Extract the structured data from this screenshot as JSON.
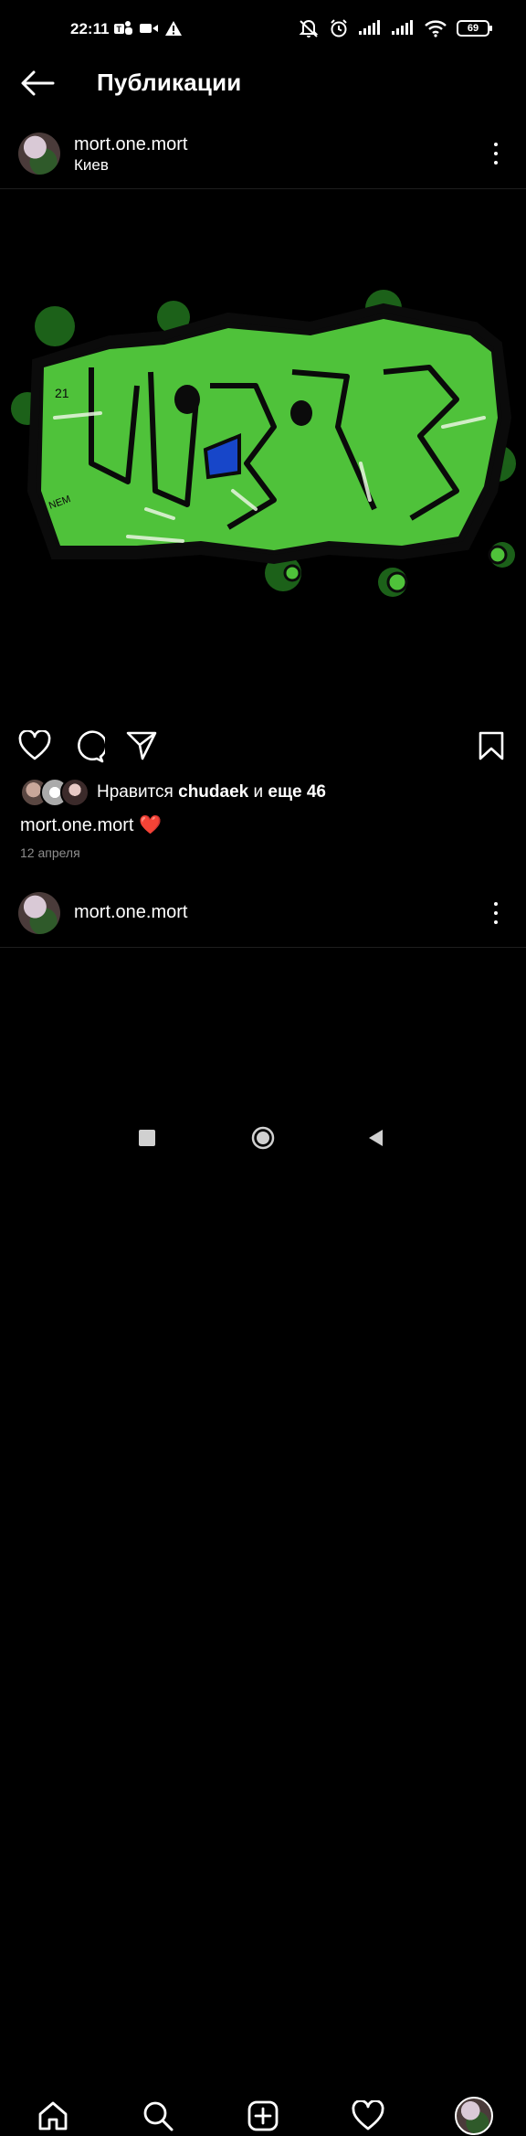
{
  "status_bar": {
    "time": "22:11",
    "battery": "69"
  },
  "header": {
    "title": "Публикации"
  },
  "post": {
    "username": "mort.one.mort",
    "location": "Киев",
    "likes_prefix": "Нравится",
    "likes_user": "chudaek",
    "likes_conjunction": "и",
    "likes_more": "еще 46",
    "caption_user": "mort.one.mort",
    "caption_emoji": "❤️",
    "date": "12 апреля",
    "image_description": "green graffiti artwork"
  },
  "next_post": {
    "username": "mort.one.mort"
  },
  "bottom_nav": {
    "items": [
      "home-icon",
      "search-icon",
      "add-post-icon",
      "heart-icon",
      "profile-avatar"
    ]
  },
  "colors": {
    "background": "#000000",
    "text": "#ffffff",
    "secondary_text": "#8e8e8e",
    "heart": "#e0245e",
    "graffiti_green": "#4fc23a"
  }
}
